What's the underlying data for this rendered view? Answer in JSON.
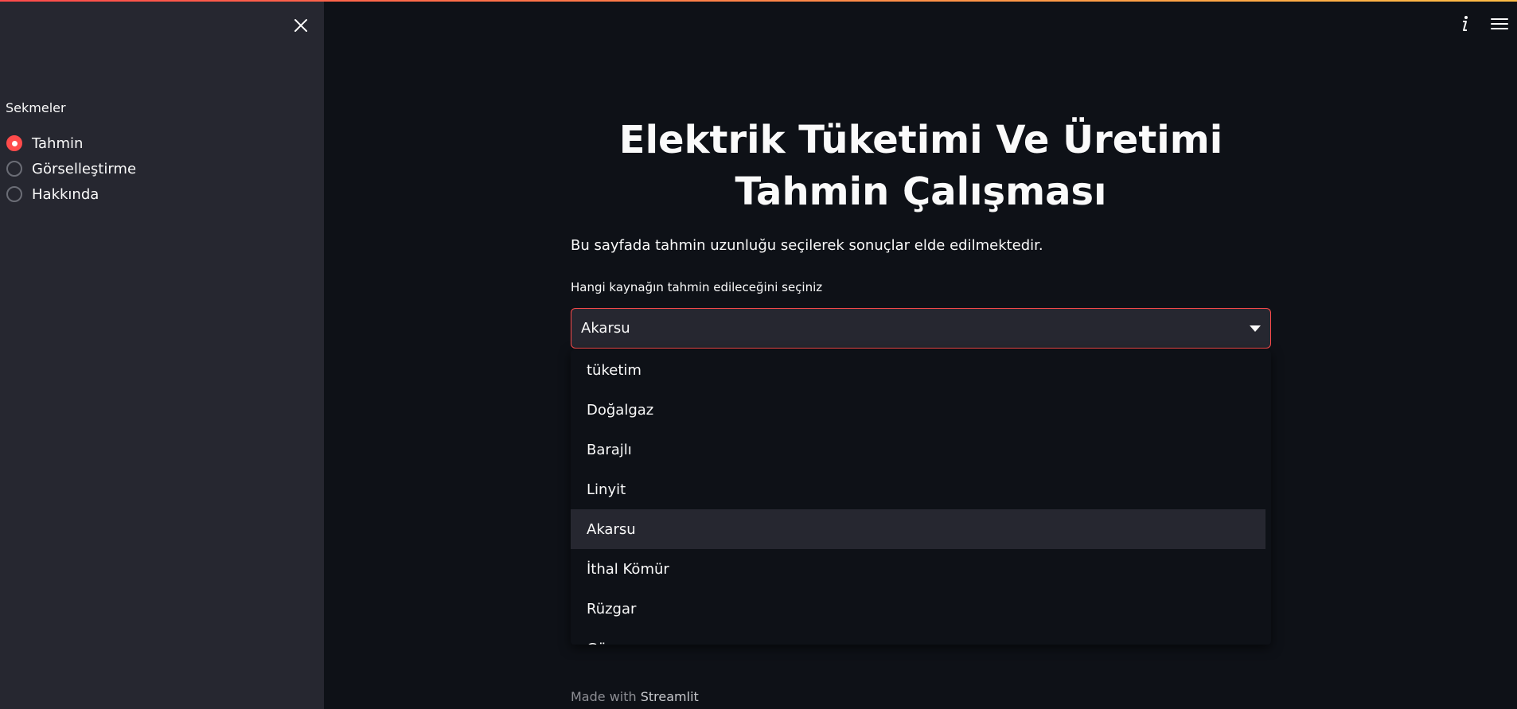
{
  "sidebar": {
    "radio_title": "Sekmeler",
    "items": [
      {
        "label": "Tahmin",
        "selected": true
      },
      {
        "label": "Görselleştirme",
        "selected": false
      },
      {
        "label": "Hakkında",
        "selected": false
      }
    ],
    "close_icon": "close-icon"
  },
  "header": {
    "info_icon": "info-icon",
    "menu_icon": "hamburger-menu-icon"
  },
  "main": {
    "title": "Elektrik Tüketimi Ve Üretimi Tahmin Çalışması",
    "description": "Bu sayfada tahmin uzunluğu seçilerek sonuçlar elde edilmektedir.",
    "select": {
      "label": "Hangi kaynağın tahmin edileceğini seçiniz",
      "value": "Akarsu",
      "options": [
        "tüketim",
        "Doğalgaz",
        "Barajlı",
        "Linyit",
        "Akarsu",
        "İthal Kömür",
        "Rüzgar",
        "Güneş"
      ],
      "highlighted": "Akarsu"
    },
    "footer": {
      "prefix": "Made with ",
      "brand": "Streamlit"
    }
  },
  "colors": {
    "accent": "#ff4b4b",
    "background": "#0e1117",
    "sidebar": "#262730"
  }
}
